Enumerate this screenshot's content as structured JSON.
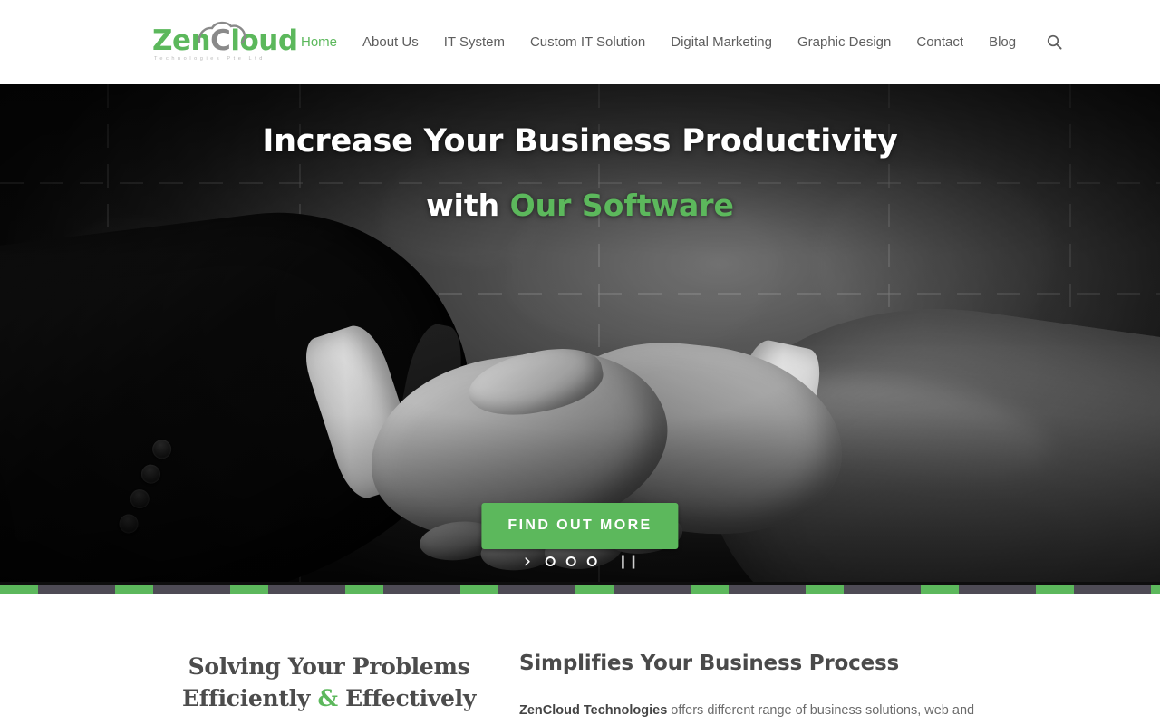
{
  "brand": {
    "name_part1": "Zen",
    "name_part2": "C",
    "name_part3": "loud",
    "tagline": "Technologies Pte Ltd",
    "accent_color": "#5cb85c",
    "grey_color": "#8a8a8a"
  },
  "nav": {
    "items": [
      {
        "label": "Home",
        "active": true
      },
      {
        "label": "About Us",
        "active": false
      },
      {
        "label": "IT System",
        "active": false
      },
      {
        "label": "Custom IT Solution",
        "active": false
      },
      {
        "label": "Digital Marketing",
        "active": false
      },
      {
        "label": "Graphic Design",
        "active": false
      },
      {
        "label": "Contact",
        "active": false
      },
      {
        "label": "Blog",
        "active": false
      }
    ],
    "search_icon": "search-icon"
  },
  "hero": {
    "title_line1": "Increase Your Business Productivity",
    "title_line2_plain": "with ",
    "title_line2_accent": "Our Software",
    "cta_label": "FIND OUT MORE",
    "controls": {
      "next_icon": "›",
      "pause_icon": "❙❙",
      "dots": 3,
      "active_dot": 0
    },
    "image_description": "black-and-white business handshake over world map"
  },
  "divider": {
    "green": "#5cb85c",
    "dark": "#4e4b55"
  },
  "intro": {
    "heading_line1": "Solving Your Problems",
    "heading_line2_pre": "Efficiently ",
    "heading_line2_accent": "&",
    "heading_line2_post": " Effectively",
    "subheading": "Simplifies Your Business Process",
    "paragraph_bold": "ZenCloud Technologies",
    "paragraph_rest": " offers different range of business solutions, web and"
  }
}
